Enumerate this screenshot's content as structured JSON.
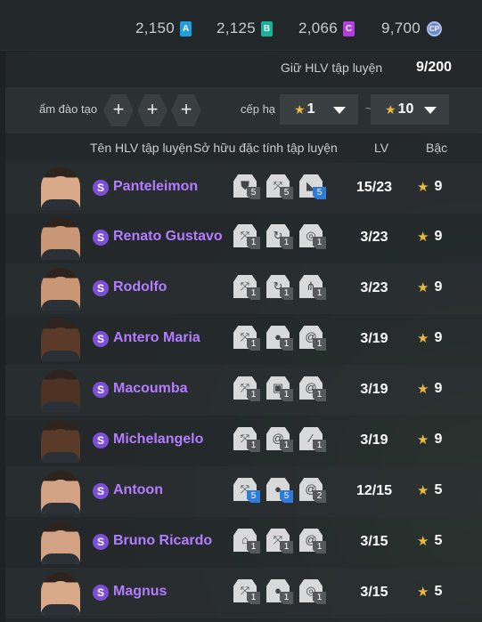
{
  "currencies": [
    {
      "value": "2,150",
      "badge": "A",
      "color": "#1e9fe0"
    },
    {
      "value": "2,125",
      "badge": "B",
      "color": "#19b39a"
    },
    {
      "value": "2,066",
      "badge": "C",
      "color": "#b43de0"
    },
    {
      "value": "9,700",
      "badge": "CP",
      "color": "#6f88d6"
    }
  ],
  "capacity": {
    "label": "Giữ HLV tập luyện",
    "value": "9/200"
  },
  "filters": {
    "training_label": "ẩm đào tạo",
    "plus_symbol": "+",
    "rank_label": "cếp hạ",
    "rank_from": "1",
    "rank_to": "10",
    "separator": "~"
  },
  "columns": {
    "name": "Tên HLV tập luyện",
    "traits": "Sở hữu đặc tính tập luyện",
    "lv": "LV",
    "grade": "Bậc"
  },
  "coaches": [
    {
      "name": "Panteleimon",
      "lv": "15/23",
      "grade": "9",
      "skin": "#d9a98a",
      "traits": [
        {
          "icon": "shield-icon",
          "level": "5"
        },
        {
          "icon": "arrows-icon",
          "level": "5"
        },
        {
          "icon": "boot-icon",
          "level": "5"
        }
      ]
    },
    {
      "name": "Renato Gustavo",
      "lv": "3/23",
      "grade": "9",
      "skin": "#c99776",
      "traits": [
        {
          "icon": "arrows-icon",
          "level": "1"
        },
        {
          "icon": "curve-icon",
          "level": "1"
        },
        {
          "icon": "target-icon",
          "level": "1"
        }
      ]
    },
    {
      "name": "Rodolfo",
      "lv": "3/23",
      "grade": "9",
      "skin": "#c99776",
      "traits": [
        {
          "icon": "arrows-icon",
          "level": "1"
        },
        {
          "icon": "curve-icon",
          "level": "1"
        },
        {
          "icon": "claw-icon",
          "level": "1"
        }
      ]
    },
    {
      "name": "Antero Maria",
      "lv": "3/19",
      "grade": "9",
      "skin": "#5a3a28",
      "traits": [
        {
          "icon": "arrows-icon",
          "level": "1"
        },
        {
          "icon": "ball-icon",
          "level": "1"
        },
        {
          "icon": "swirl-icon",
          "level": "1"
        }
      ]
    },
    {
      "name": "Macoumba",
      "lv": "3/19",
      "grade": "9",
      "skin": "#4e3324",
      "traits": [
        {
          "icon": "arrows-icon",
          "level": "1"
        },
        {
          "icon": "lock-icon",
          "level": "1"
        },
        {
          "icon": "swirl-icon",
          "level": "1"
        }
      ]
    },
    {
      "name": "Michelangelo",
      "lv": "3/19",
      "grade": "9",
      "skin": "#5a3a28",
      "traits": [
        {
          "icon": "arrows-icon",
          "level": "1"
        },
        {
          "icon": "swirl-icon",
          "level": "1"
        },
        {
          "icon": "wand-icon",
          "level": "1"
        }
      ]
    },
    {
      "name": "Antoon",
      "lv": "12/15",
      "grade": "5",
      "skin": "#d3a285",
      "traits": [
        {
          "icon": "arrows-icon",
          "level": "5"
        },
        {
          "icon": "ball-icon",
          "level": "5"
        },
        {
          "icon": "swirl-icon",
          "level": "2"
        }
      ]
    },
    {
      "name": "Bruno Ricardo",
      "lv": "3/15",
      "grade": "5",
      "skin": "#d3a285",
      "traits": [
        {
          "icon": "goal-icon",
          "level": "1"
        },
        {
          "icon": "arrows-icon",
          "level": "1"
        },
        {
          "icon": "swirl-icon",
          "level": "1"
        }
      ]
    },
    {
      "name": "Magnus",
      "lv": "3/15",
      "grade": "5",
      "skin": "#d9a98a",
      "traits": [
        {
          "icon": "arrows-icon",
          "level": "1"
        },
        {
          "icon": "ball-icon",
          "level": "1"
        },
        {
          "icon": "target-icon",
          "level": "1"
        }
      ]
    }
  ]
}
